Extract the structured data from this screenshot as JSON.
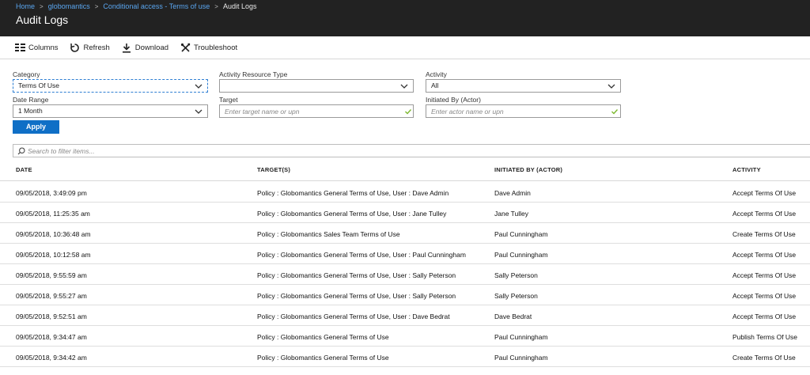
{
  "breadcrumb": {
    "items": [
      "Home",
      "globomantics",
      "Conditional access - Terms of use"
    ],
    "current": "Audit Logs"
  },
  "page_title": "Audit Logs",
  "toolbar": {
    "columns": "Columns",
    "refresh": "Refresh",
    "download": "Download",
    "troubleshoot": "Troubleshoot"
  },
  "filters": {
    "category": {
      "label": "Category",
      "value": "Terms Of Use"
    },
    "resource_type": {
      "label": "Activity Resource Type",
      "value": ""
    },
    "activity": {
      "label": "Activity",
      "value": "All"
    },
    "date_range": {
      "label": "Date Range",
      "value": "1 Month"
    },
    "target": {
      "label": "Target",
      "placeholder": "Enter target name or upn"
    },
    "initiated_by": {
      "label": "Initiated By (Actor)",
      "placeholder": "Enter actor name or upn"
    },
    "apply": "Apply"
  },
  "search": {
    "placeholder": "Search to filter items..."
  },
  "table": {
    "headers": [
      "DATE",
      "TARGET(S)",
      "INITIATED BY (ACTOR)",
      "ACTIVITY"
    ],
    "rows": [
      [
        "09/05/2018, 3:49:09 pm",
        "Policy : Globomantics General Terms of Use, User : Dave Admin",
        "Dave Admin",
        "Accept Terms Of Use"
      ],
      [
        "09/05/2018, 11:25:35 am",
        "Policy : Globomantics General Terms of Use, User : Jane Tulley",
        "Jane Tulley",
        "Accept Terms Of Use"
      ],
      [
        "09/05/2018, 10:36:48 am",
        "Policy : Globomantics Sales Team Terms of Use",
        "Paul Cunningham",
        "Create Terms Of Use"
      ],
      [
        "09/05/2018, 10:12:58 am",
        "Policy : Globomantics General Terms of Use, User : Paul Cunningham",
        "Paul Cunningham",
        "Accept Terms Of Use"
      ],
      [
        "09/05/2018, 9:55:59 am",
        "Policy : Globomantics General Terms of Use, User : Sally Peterson",
        "Sally Peterson",
        "Accept Terms Of Use"
      ],
      [
        "09/05/2018, 9:55:27 am",
        "Policy : Globomantics General Terms of Use, User : Sally Peterson",
        "Sally Peterson",
        "Accept Terms Of Use"
      ],
      [
        "09/05/2018, 9:52:51 am",
        "Policy : Globomantics General Terms of Use, User : Dave Bedrat",
        "Dave Bedrat",
        "Accept Terms Of Use"
      ],
      [
        "09/05/2018, 9:34:47 am",
        "Policy : Globomantics General Terms of Use",
        "Paul Cunningham",
        "Publish Terms Of Use"
      ],
      [
        "09/05/2018, 9:34:42 am",
        "Policy : Globomantics General Terms of Use",
        "Paul Cunningham",
        "Create Terms Of Use"
      ]
    ]
  },
  "colors": {
    "header_bg": "#222222",
    "link": "#5aa6f0",
    "accent": "#0f6fc6",
    "check": "#7cb82f"
  }
}
